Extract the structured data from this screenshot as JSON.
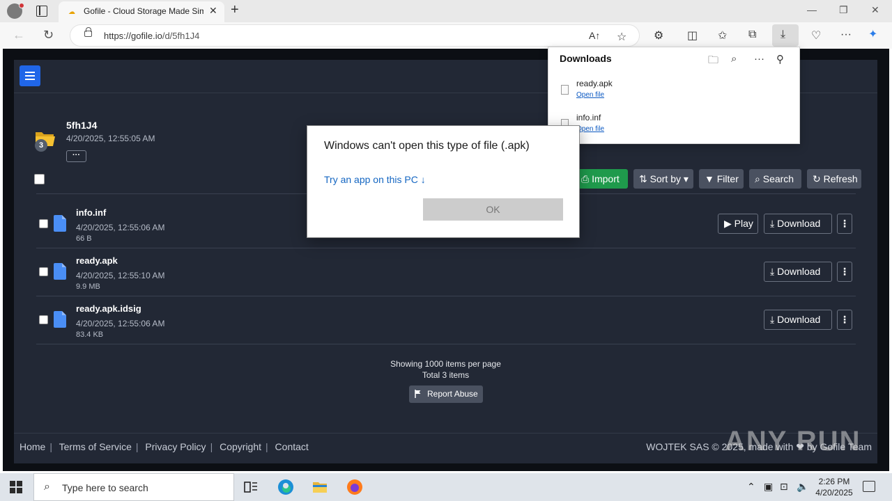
{
  "browser": {
    "tab_title": "Gofile - Cloud Storage Made Simple",
    "url_domain": "https://gofile.io",
    "url_path": "/d/5fh1J4",
    "new_tab": "+",
    "close_tab": "✕",
    "win_minimize": "—",
    "win_restore": "❐",
    "win_close": "✕"
  },
  "downloads_panel": {
    "title": "Downloads",
    "items": [
      {
        "name": "ready.apk",
        "action": "Open file"
      },
      {
        "name": "info.inf",
        "action": "Open file"
      }
    ]
  },
  "folder": {
    "name": "5fh1J4",
    "date": "4/20/2025, 12:55:05 AM",
    "count": "3",
    "more": "···"
  },
  "toolbar": {
    "import": "Import",
    "sort_by": "Sort by",
    "filter": "Filter",
    "search": "Search",
    "refresh": "Refresh"
  },
  "files": [
    {
      "name": "info.inf",
      "date": "4/20/2025, 12:55:06 AM",
      "size": "66 B",
      "play": "Play",
      "download": "Download"
    },
    {
      "name": "ready.apk",
      "date": "4/20/2025, 12:55:10 AM",
      "size": "9.9 MB",
      "download": "Download"
    },
    {
      "name": "ready.apk.idsig",
      "date": "4/20/2025, 12:55:06 AM",
      "size": "83.4 KB",
      "download": "Download"
    }
  ],
  "listing": {
    "per_page": "Showing 1000 items per page",
    "total": "Total 3 items",
    "report": "Report Abuse"
  },
  "footer": {
    "links": [
      "Home",
      "Terms of Service",
      "Privacy Policy",
      "Copyright",
      "Contact"
    ],
    "right": "WOJTEK SAS © 2025, made with ❤ by Gofile Team"
  },
  "watermark": "ANY RUN",
  "dialog": {
    "title": "Windows can't open this type of file (.apk)",
    "link": "Try an app on this PC ↓",
    "ok": "OK"
  },
  "taskbar": {
    "search_placeholder": "Type here to search",
    "time": "2:26 PM",
    "date": "4/20/2025"
  },
  "colors": {
    "accent": "#2066e8",
    "import_green": "#1f9a4c",
    "page_bg": "#222835",
    "dialog_link": "#1466c2"
  }
}
